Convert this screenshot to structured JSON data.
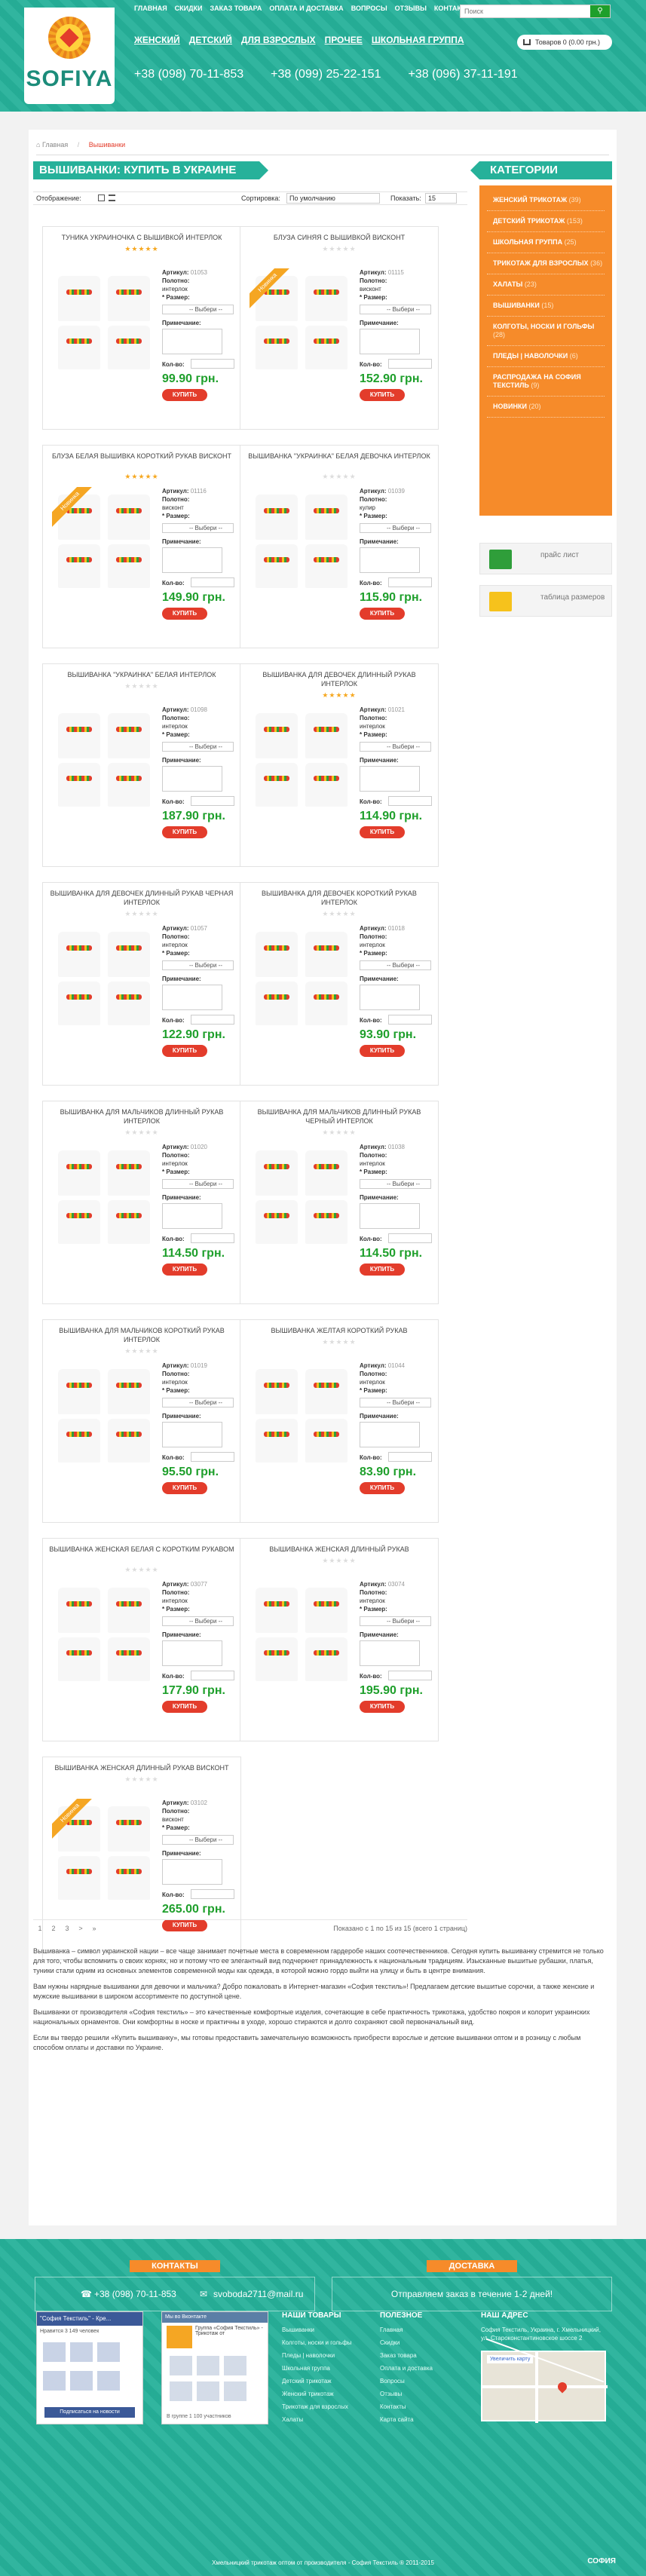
{
  "header": {
    "brand": "SOFIYA",
    "top_nav": [
      "ГЛАВНАЯ",
      "СКИДКИ",
      "ЗАКАЗ ТОВАРА",
      "ОПЛАТА И ДОСТАВКА",
      "ВОПРОСЫ",
      "ОТЗЫВЫ",
      "КОНТАКТЫ"
    ],
    "search_placeholder": "Поиск",
    "main_nav": [
      "ЖЕНСКИЙ",
      "ДЕТСКИЙ",
      "ДЛЯ ВЗРОСЛЫХ",
      "ПРОЧЕЕ",
      "ШКОЛЬНАЯ ГРУППА"
    ],
    "cart": "Товаров 0 (0.00 грн.)",
    "phones": [
      "+38 (098) 70-11-853",
      "+38 (099) 25-22-151",
      "+38 (096) 37-11-191"
    ]
  },
  "breadcrumb": {
    "home": "Главная",
    "current": "Вышиванки"
  },
  "page_title": "ВЫШИВАНКИ: КУПИТЬ В УКРАИНЕ",
  "toolbar": {
    "view_label": "Отображение:",
    "sort_label": "Сортировка:",
    "sort_value": "По умолчанию",
    "show_label": "Показать:",
    "show_value": "15"
  },
  "labels": {
    "article": "Артикул:",
    "fabric": "Полотно:",
    "size": "* Размер:",
    "choose": "-- Выбери --",
    "note": "Примечание:",
    "qty": "Кол-во:",
    "buy": "КУПИТЬ",
    "ribbon": "Новинка"
  },
  "products": [
    {
      "title": "ТУНИКА УКРАИНОЧКА С ВЫШИВКОЙ ИНТЕРЛОК",
      "article": "01053",
      "fabric": "интерлок",
      "price": "99.90 грн.",
      "rated": true,
      "ribbon": false
    },
    {
      "title": "БЛУЗА СИНЯЯ С ВЫШИВКОЙ ВИСКОНТ",
      "article": "01115",
      "fabric": "висконт",
      "price": "152.90 грн.",
      "rated": false,
      "ribbon": true
    },
    {
      "title": "БЛУЗА БЕЛАЯ ВЫШИВКА КОРОТКИЙ РУКАВ ВИСКОНТ",
      "article": "01116",
      "fabric": "висконт",
      "price": "149.90 грн.",
      "rated": true,
      "ribbon": true
    },
    {
      "title": "ВЫШИВАНКА \"УКРАИНКА\" БЕЛАЯ ДЕВОЧКА ИНТЕРЛОК",
      "article": "01039",
      "fabric": "кулир",
      "price": "115.90 грн.",
      "rated": false,
      "ribbon": false
    },
    {
      "title": "ВЫШИВАНКА \"УКРАИНКА\" БЕЛАЯ ИНТЕРЛОК",
      "article": "01098",
      "fabric": "интерлок",
      "price": "187.90 грн.",
      "rated": false,
      "ribbon": false
    },
    {
      "title": "ВЫШИВАНКА ДЛЯ ДЕВОЧЕК ДЛИННЫЙ РУКАВ ИНТЕРЛОК",
      "article": "01021",
      "fabric": "интерлок",
      "price": "114.90 грн.",
      "rated": true,
      "ribbon": false
    },
    {
      "title": "ВЫШИВАНКА ДЛЯ ДЕВОЧЕК ДЛИННЫЙ РУКАВ ЧЕРНАЯ ИНТЕРЛОК",
      "article": "01057",
      "fabric": "интерлок",
      "price": "122.90 грн.",
      "rated": false,
      "ribbon": false
    },
    {
      "title": "ВЫШИВАНКА ДЛЯ ДЕВОЧЕК КОРОТКИЙ РУКАВ ИНТЕРЛОК",
      "article": "01018",
      "fabric": "интерлок",
      "price": "93.90 грн.",
      "rated": false,
      "ribbon": false
    },
    {
      "title": "ВЫШИВАНКА ДЛЯ МАЛЬЧИКОВ ДЛИННЫЙ РУКАВ ИНТЕРЛОК",
      "article": "01020",
      "fabric": "интерлок",
      "price": "114.50 грн.",
      "rated": false,
      "ribbon": false
    },
    {
      "title": "ВЫШИВАНКА ДЛЯ МАЛЬЧИКОВ ДЛИННЫЙ РУКАВ ЧЕРНЫЙ ИНТЕРЛОК",
      "article": "01038",
      "fabric": "интерлок",
      "price": "114.50 грн.",
      "rated": false,
      "ribbon": false
    },
    {
      "title": "ВЫШИВАНКА ДЛЯ МАЛЬЧИКОВ КОРОТКИЙ РУКАВ ИНТЕРЛОК",
      "article": "01019",
      "fabric": "интерлок",
      "price": "95.50 грн.",
      "rated": false,
      "ribbon": false
    },
    {
      "title": "ВЫШИВАНКА ЖЕЛТАЯ КОРОТКИЙ РУКАВ",
      "article": "01044",
      "fabric": "интерлок",
      "price": "83.90 грн.",
      "rated": false,
      "ribbon": false
    },
    {
      "title": "ВЫШИВАНКА ЖЕНСКАЯ БЕЛАЯ С КОРОТКИМ РУКАВОМ",
      "article": "03077",
      "fabric": "интерлок",
      "price": "177.90 грн.",
      "rated": false,
      "ribbon": false
    },
    {
      "title": "ВЫШИВАНКА ЖЕНСКАЯ ДЛИННЫЙ РУКАВ",
      "article": "03074",
      "fabric": "интерлок",
      "price": "195.90 грн.",
      "rated": false,
      "ribbon": false
    },
    {
      "title": "ВЫШИВАНКА ЖЕНСКАЯ ДЛИННЫЙ РУКАВ ВИСКОНТ",
      "article": "03102",
      "fabric": "висконт",
      "price": "265.00 грн.",
      "rated": false,
      "ribbon": true
    }
  ],
  "sidebar": {
    "title": "КАТЕГОРИИ",
    "categories": [
      {
        "label": "ЖЕНСКИЙ ТРИКОТАЖ",
        "count": "(39)"
      },
      {
        "label": "ДЕТСКИЙ ТРИКОТАЖ",
        "count": "(153)"
      },
      {
        "label": "ШКОЛЬНАЯ ГРУППА",
        "count": "(25)"
      },
      {
        "label": "ТРИКОТАЖ ДЛЯ ВЗРОСЛЫХ",
        "count": "(36)"
      },
      {
        "label": "ХАЛАТЫ",
        "count": "(23)"
      },
      {
        "label": "ВЫШИВАНКИ",
        "count": "(15)"
      },
      {
        "label": "КОЛГОТЫ, НОСКИ И ГОЛЬФЫ",
        "count": "(28)"
      },
      {
        "label": "ПЛЕДЫ | НАВОЛОЧКИ",
        "count": "(6)"
      },
      {
        "label": "РАСПРОДАЖА НА СОФИЯ ТЕКСТИЛЬ",
        "count": "(9)"
      },
      {
        "label": "НОВИНКИ",
        "count": "(20)"
      }
    ],
    "price_list": "прайс лист",
    "size_table": "таблица размеров"
  },
  "pager": {
    "pages": [
      "1",
      "2",
      "3",
      ">",
      "»"
    ],
    "info": "Показано с 1 по 15 из 15 (всего 1 страниц)"
  },
  "seo": [
    "Вышиванка – символ украинской нации – все чаще занимает почетные места в современном гардеробе наших соотечественников. Сегодня купить вышиванку стремится не только для того, чтобы вспомнить о своих корнях, но и потому что ее элегантный вид подчеркнет принадлежность к национальным традициям. Изысканные вышитые рубашки, платья, туники стали одним из основных элементов современной моды как одежда, в которой можно гордо выйти на улицу и быть в центре внимания.",
    "Вам нужны нарядные вышиванки для девочки и мальчика? Добро пожаловать в Интернет-магазин «София текстиль»! Предлагаем детские вышитые сорочки, а также женские и мужские вышиванки в широком ассортименте по доступной цене.",
    "Вышиванки от производителя «София текстиль» – это качественные комфортные изделия, сочетающие в себе практичность трикотажа, удобство покроя и колорит украинских национальных орнаментов. Они комфортны в носке и практичны в уходе, хорошо стираются и долго сохраняют свой первоначальный вид.",
    "Если вы твердо решили «Купить вышиванку», мы готовы предоставить замечательную возможность приобрести взрослые и детские вышиванки оптом и в розницу с любым способом оплаты и доставки по Украине."
  ],
  "footer": {
    "contacts_title": "КОНТАКТЫ",
    "delivery_title": "ДОСТАВКА",
    "phone": "+38 (098) 70-11-853",
    "email": "svoboda2711@mail.ru",
    "delivery_text": "Отправляем заказ в течение 1-2 дней!",
    "fb_header": "\"София Текстиль\" - Кре...",
    "fb_likes": "Нравится 3 149 человек",
    "fb_button": "Подписаться на новости",
    "vk_header": "Мы во Вконтакте",
    "vk_group": "Группа «София Текстиль» - Трикотаж от",
    "vk_members": "В группе 1 100 участников",
    "col_goods_title": "НАШИ ТОВАРЫ",
    "col_goods": [
      "Вышиванки",
      "Колготы, носки и гольфы",
      "Пледы | наволочки",
      "Школьная группа",
      "Детский трикотаж",
      "Женский трикотаж",
      "Трикотаж для взрослых",
      "Халаты"
    ],
    "col_useful_title": "ПОЛЕЗНОЕ",
    "col_useful": [
      "Главная",
      "Скидки",
      "Заказ товара",
      "Оплата и доставка",
      "Вопросы",
      "Отзывы",
      "Контакты",
      "Карта сайта"
    ],
    "col_address_title": "НАШ АДРЕС",
    "address": "София Текстиль, Украина, г. Хмельницкий, ул. Староконстантиновское шоссе 2",
    "map_button": "Увеличить карту",
    "copyright": "Хмельницкий трикотаж оптом от производителя - София Текстиль ® 2011-2015",
    "dev": "СОФИЯ"
  }
}
